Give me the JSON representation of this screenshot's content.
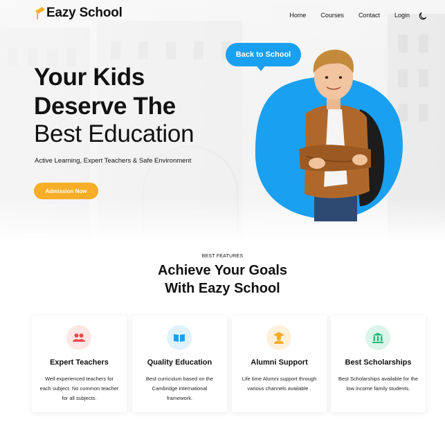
{
  "brand": {
    "name": "Eazy School",
    "accent": "#f6ad27",
    "blue": "#1aa0f0"
  },
  "nav": {
    "items": [
      {
        "label": "Home"
      },
      {
        "label": "Courses"
      },
      {
        "label": "Contact"
      },
      {
        "label": "Login"
      }
    ],
    "theme_icon": "moon-icon"
  },
  "hero": {
    "title_line1": "Your Kids",
    "title_line2": "Deserve The",
    "title_line3": "Best Education",
    "tagline": "Active Learning, Expert Teachers & Safe Environment",
    "cta_label": "Admission Now",
    "bubble_text": "Back to School"
  },
  "features": {
    "eyebrow": "BEST FEATURES",
    "title_line1": "Achieve Your Goals",
    "title_line2": "With Eazy School",
    "cards": [
      {
        "title": "Expert Teachers",
        "description": "Well experienced teachers for each subject. No common teacher for all subjects.",
        "icon": "users-icon",
        "icon_bg": "#fde6e6",
        "icon_color": "#e94b4b"
      },
      {
        "title": "Quality Education",
        "description": "Best curriculum based on the Cambridge international framework.",
        "icon": "book-icon",
        "icon_bg": "#e1f2fc",
        "icon_color": "#1aa0f0"
      },
      {
        "title": "Alumni Support",
        "description": "Life time Alumni support through various channels available .",
        "icon": "graduate-icon",
        "icon_bg": "#fdf1dc",
        "icon_color": "#f6ad27"
      },
      {
        "title": "Best Scholarships",
        "description": "Best Scholarships available for the low income family students.",
        "icon": "bank-icon",
        "icon_bg": "#dcf5ea",
        "icon_color": "#1fb877"
      }
    ]
  }
}
